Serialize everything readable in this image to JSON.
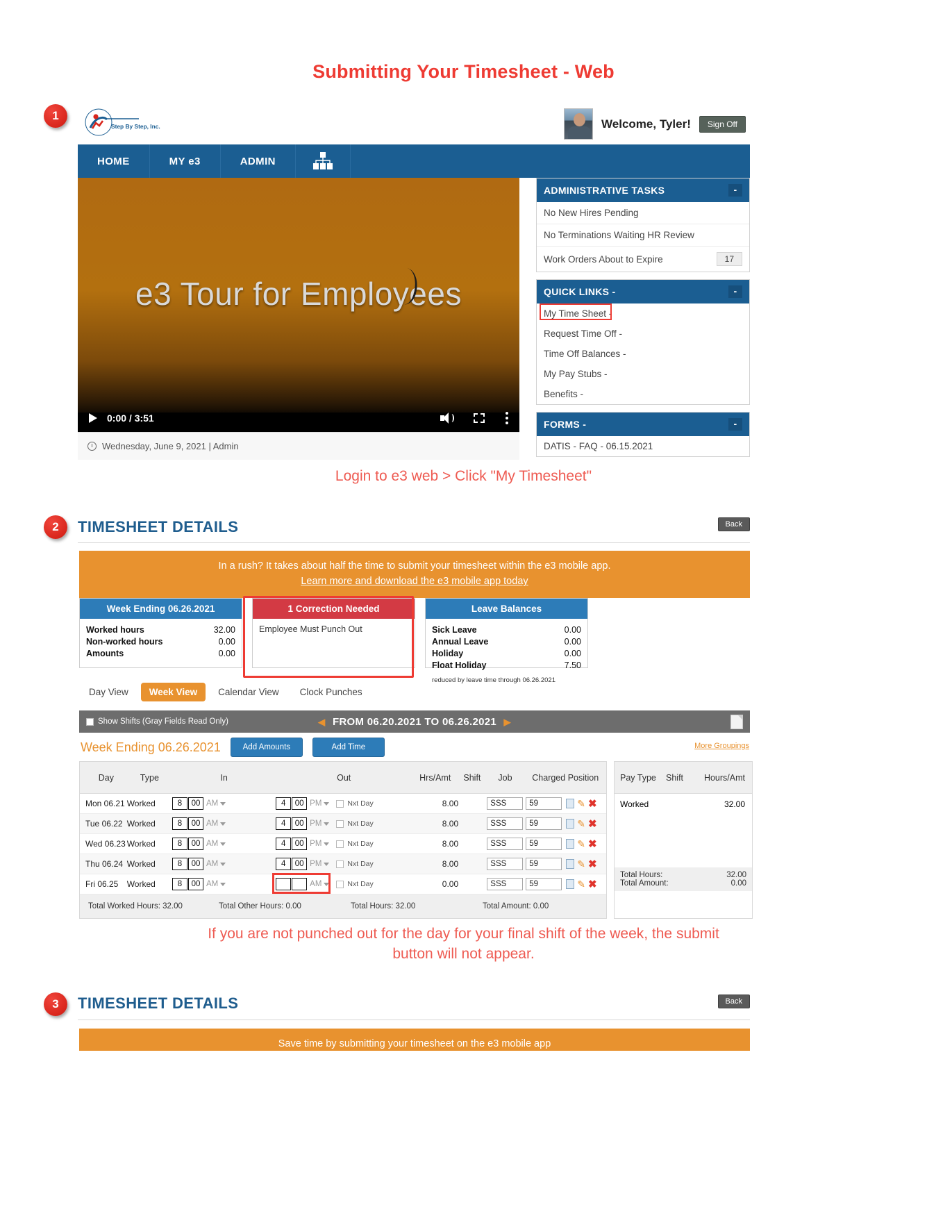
{
  "doc": {
    "title": "Submitting Your Timesheet - Web",
    "step1_caption": "Login to e3 web > Click \"My Timesheet\"",
    "step2_caption_line1": "If you are not punched out for the day for your final shift of the week, the submit",
    "step2_caption_line2": "button will not appear.",
    "steps": [
      "1",
      "2",
      "3"
    ],
    "accent_red": "#ee3b33",
    "accent_blue": "#1b5e92",
    "accent_orange": "#e8922f"
  },
  "app_header": {
    "logo_text": "Step By Step, Inc.",
    "welcome": "Welcome, Tyler!",
    "sign_off": "Sign Off",
    "nav": [
      {
        "label": "HOME",
        "active": true
      },
      {
        "label": "MY e3",
        "active": false
      },
      {
        "label": "ADMIN",
        "active": false
      },
      {
        "label": "",
        "active": false,
        "icon": "org-chart-icon"
      }
    ]
  },
  "video": {
    "title": "e3 Tour for Employees",
    "time": "0:00 / 3:51",
    "meta": "Wednesday, June 9, 2021 | Admin"
  },
  "admin_tasks": {
    "heading": "ADMINISTRATIVE TASKS",
    "collapse": "-",
    "rows": [
      {
        "label": "No New Hires Pending",
        "count": ""
      },
      {
        "label": "No Terminations Waiting HR Review",
        "count": ""
      },
      {
        "label": "Work Orders About to Expire",
        "count": "17"
      }
    ]
  },
  "quick_links": {
    "heading": "QUICK LINKS -",
    "collapse": "-",
    "items": [
      {
        "label": "My Time Sheet -",
        "highlighted": true
      },
      {
        "label": "Request Time Off -",
        "highlighted": false
      },
      {
        "label": "Time Off Balances -",
        "highlighted": false
      },
      {
        "label": "My Pay Stubs -",
        "highlighted": false
      },
      {
        "label": "Benefits -",
        "highlighted": false
      }
    ]
  },
  "forms": {
    "heading": "FORMS -",
    "collapse": "-",
    "items": [
      "DATIS - FAQ - 06.15.2021"
    ]
  },
  "timesheet": {
    "section_title": "TIMESHEET DETAILS",
    "back_label": "Back",
    "promo_line1": "In a rush? It takes about half the time to submit your timesheet within the e3 mobile app.",
    "promo_link": "Learn more and download the e3 mobile app today",
    "cards": {
      "week": {
        "title": "Week Ending 06.26.2021",
        "rows": [
          {
            "label": "Worked hours",
            "value": "32.00"
          },
          {
            "label": "Non-worked hours",
            "value": "0.00"
          },
          {
            "label": "Amounts",
            "value": "0.00"
          }
        ]
      },
      "correction": {
        "title": "1 Correction Needed",
        "text": "Employee Must Punch Out"
      },
      "leave": {
        "title": "Leave Balances",
        "rows": [
          {
            "label": "Sick Leave",
            "value": "0.00"
          },
          {
            "label": "Annual Leave",
            "value": "0.00"
          },
          {
            "label": "Holiday",
            "value": "0.00"
          },
          {
            "label": "Float Holiday",
            "value": "7.50"
          }
        ],
        "note": "reduced by leave time through 06.26.2021"
      }
    },
    "tabs": [
      {
        "label": "Day View",
        "active": false
      },
      {
        "label": "Week View",
        "active": true
      },
      {
        "label": "Calendar View",
        "active": false
      },
      {
        "label": "Clock Punches",
        "active": false
      }
    ],
    "graybar": {
      "show_shifts": "Show Shifts (Gray Fields Read Only)",
      "range": "FROM 06.20.2021 TO 06.26.2021",
      "prev": "◀",
      "next": "▶"
    },
    "week_ending_label": "Week Ending 06.26.2021",
    "add_amounts": "Add Amounts",
    "add_time": "Add Time",
    "more_groupings": "More Groupings",
    "table": {
      "headers": [
        "Day",
        "Type",
        "In",
        "Out",
        "Hrs/Amt",
        "Shift",
        "Job",
        "Charged Position"
      ],
      "nxt_day_label": "Nxt Day",
      "rows": [
        {
          "day": "Mon 06.21",
          "type": "Worked",
          "in_h": "8",
          "in_m": "00",
          "in_ap": "AM",
          "out_h": "4",
          "out_m": "00",
          "out_ap": "PM",
          "hrs": "8.00",
          "shift": "",
          "job": "SSS",
          "pos": "59"
        },
        {
          "day": "Tue 06.22",
          "type": "Worked",
          "in_h": "8",
          "in_m": "00",
          "in_ap": "AM",
          "out_h": "4",
          "out_m": "00",
          "out_ap": "PM",
          "hrs": "8.00",
          "shift": "",
          "job": "SSS",
          "pos": "59"
        },
        {
          "day": "Wed 06.23",
          "type": "Worked",
          "in_h": "8",
          "in_m": "00",
          "in_ap": "AM",
          "out_h": "4",
          "out_m": "00",
          "out_ap": "PM",
          "hrs": "8.00",
          "shift": "",
          "job": "SSS",
          "pos": "59"
        },
        {
          "day": "Thu 06.24",
          "type": "Worked",
          "in_h": "8",
          "in_m": "00",
          "in_ap": "AM",
          "out_h": "4",
          "out_m": "00",
          "out_ap": "PM",
          "hrs": "8.00",
          "shift": "",
          "job": "SSS",
          "pos": "59"
        },
        {
          "day": "Fri 06.25",
          "type": "Worked",
          "in_h": "8",
          "in_m": "00",
          "in_ap": "AM",
          "out_h": "",
          "out_m": "",
          "out_ap": "AM",
          "hrs": "0.00",
          "shift": "",
          "job": "SSS",
          "pos": "59"
        }
      ],
      "totals": [
        "Total Worked Hours: 32.00",
        "Total Other Hours: 0.00",
        "Total Hours: 32.00",
        "Total Amount: 0.00"
      ]
    },
    "side": {
      "headers": [
        "Pay Type",
        "Shift",
        "Hours/Amt"
      ],
      "rows": [
        {
          "pay_type": "Worked",
          "shift": "",
          "hours": "32.00"
        }
      ],
      "totals": [
        {
          "label": "Total Hours:",
          "value": "32.00"
        },
        {
          "label": "Total Amount:",
          "value": "0.00"
        }
      ]
    }
  },
  "section3": {
    "title": "TIMESHEET DETAILS",
    "back_label": "Back",
    "promo_line1": "Save time by submitting your timesheet on the e3 mobile app"
  }
}
